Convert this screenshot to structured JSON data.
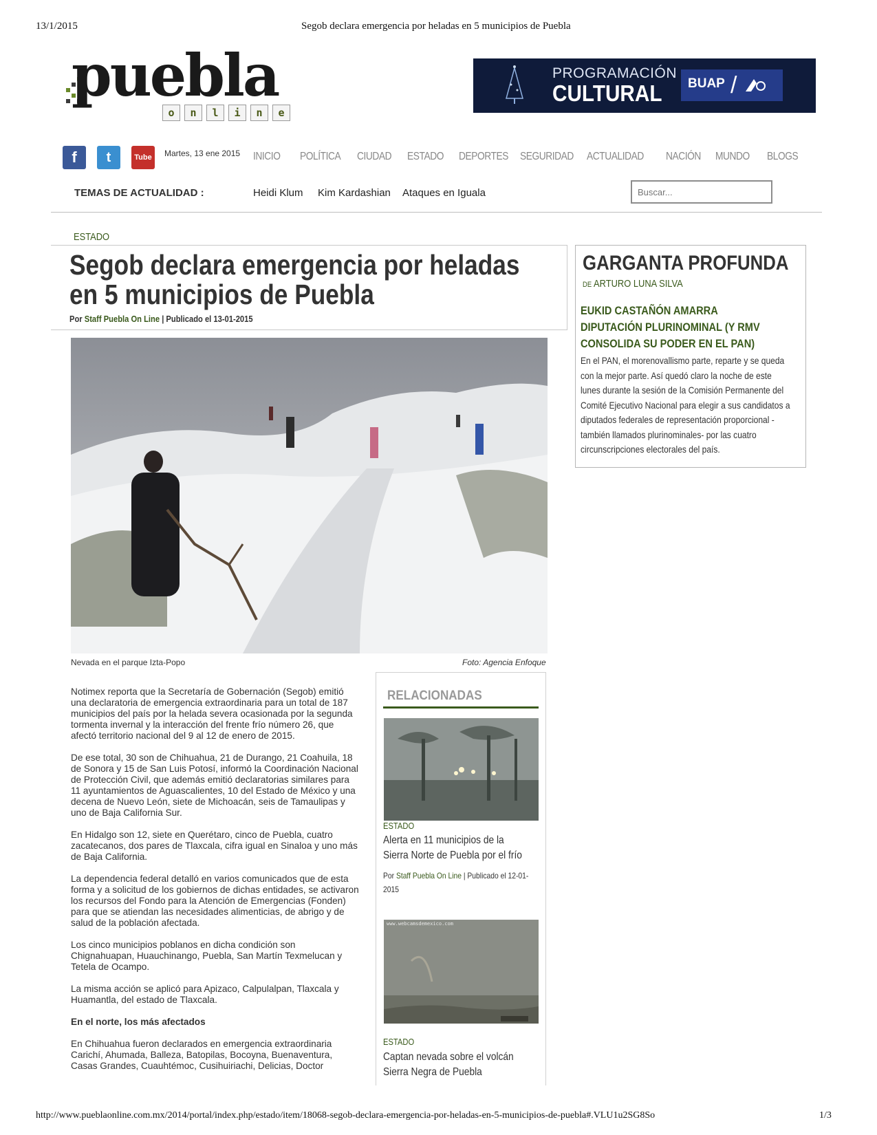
{
  "print_header": {
    "date": "13/1/2015",
    "title": "Segob declara emergencia por heladas en 5 municipios de Puebla"
  },
  "print_footer": {
    "url": "http://www.pueblaonline.com.mx/2014/portal/index.php/estado/item/18068-segob-declara-emergencia-por-heladas-en-5-municipios-de-puebla#.VLU1u2SG8So",
    "page": "1/3"
  },
  "logo": {
    "word": "puebla",
    "sub_letters": [
      "o",
      "n",
      "l",
      "i",
      "n",
      "e"
    ]
  },
  "banner": {
    "line1": "PROGRAMACIÓN",
    "line2": "CULTURAL",
    "brand": "BUAP",
    "colors": {
      "bg": "#0f1b3a",
      "brand_bg": "#253c8a"
    }
  },
  "social": {
    "facebook": "f",
    "twitter": "t",
    "youtube": "Tube"
  },
  "date_label": "Martes, 13 ene 2015",
  "nav": [
    "INICIO",
    "POLÍTICA",
    "CIUDAD",
    "ESTADO",
    "DEPORTES",
    "SEGURIDAD",
    "ACTUALIDAD",
    "NACIÓN",
    "MUNDO",
    "BLOGS"
  ],
  "topics": {
    "label": "TEMAS DE ACTUALIDAD :",
    "items": [
      "Heidi Klum",
      "Kim Kardashian",
      "Ataques en Iguala"
    ]
  },
  "search": {
    "placeholder": "Buscar..."
  },
  "article": {
    "category": "ESTADO",
    "title": "Segob declara emergencia por heladas en 5 municipios de Puebla",
    "by_prefix": "Por",
    "author": "Staff Puebla On Line",
    "published": "| Publicado el 13-01-2015",
    "image_caption": "Nevada en el parque Izta-Popo",
    "image_credit": "Foto: Agencia Enfoque",
    "paragraphs": [
      "Notimex reporta que la Secretaría de Gobernación (Segob) emitió una declaratoria de emergencia extraordinaria para un total de 187 municipios del país por la helada severa ocasionada por la segunda tormenta invernal y la interacción del frente frío número 26, que afectó territorio nacional del 9 al 12 de enero de 2015.",
      "De ese total, 30 son de Chihuahua, 21 de Durango, 21 Coahuila, 18 de Sonora y 15 de San Luis Potosí, informó la Coordinación Nacional de Protección Civil, que además emitió declaratorias similares para 11 ayuntamientos de Aguascalientes, 10 del Estado de México y una decena de Nuevo León, siete de Michoacán, seis de Tamaulipas y uno de Baja California Sur.",
      "En Hidalgo son 12, siete en Querétaro, cinco de Puebla, cuatro zacatecanos, dos pares de Tlaxcala, cifra igual en Sinaloa y uno más de Baja California.",
      "La dependencia federal detalló en varios comunicados que de esta forma y a solicitud de los gobiernos de dichas entidades, se activaron los recursos del Fondo para la Atención de Emergencias (Fonden) para que se atiendan las necesidades alimenticias, de abrigo y de salud de la población afectada.",
      "Los cinco municipios poblanos en dicha condición son Chignahuapan, Huauchinango, Puebla, San Martín Texmelucan y Tetela de Ocampo.",
      "La misma acción se aplicó para Apizaco, Calpulalpan, Tlaxcala y Huamantla, del estado de Tlaxcala."
    ],
    "subheading": "En el norte, los más afectados",
    "last_paragraph": "En Chihuahua fueron declarados en emergencia extraordinaria Carichí, Ahumada, Balleza, Batopilas, Bocoyna, Buenaventura, Casas Grandes, Cuauhtémoc, Cusihuiriachi, Delicias, Doctor"
  },
  "sidebar": {
    "column_title": "GARGANTA PROFUNDA",
    "de": "DE",
    "columnist": "ARTURO LUNA SILVA",
    "headline": "EUKID CASTAÑÓN AMARRA DIPUTACIÓN PLURINOMINAL (Y RMV CONSOLIDA SU PODER EN EL PAN)",
    "body": "En el PAN, el morenovallismo parte, reparte y se queda con la mejor parte. Así quedó claro la noche de este lunes durante la sesión de la Comisión Permanente del Comité Ejecutivo Nacional para elegir a sus candidatos a diputados federales de representación proporcional - también llamados plurinominales- por las cuatro circunscripciones electorales del país."
  },
  "related": {
    "title": "RELACIONADAS",
    "items": [
      {
        "category": "ESTADO",
        "headline": "Alerta en 11 municipios de la Sierra Norte de Puebla por el frío",
        "by_prefix": "Por",
        "author": "Staff Puebla On Line",
        "published": "| Publicado el 12-01-2015"
      },
      {
        "category": "ESTADO",
        "headline": "Captan nevada sobre el volcán Sierra Negra de Puebla",
        "cam_text": "www.webcamsdemexico.com"
      }
    ]
  }
}
